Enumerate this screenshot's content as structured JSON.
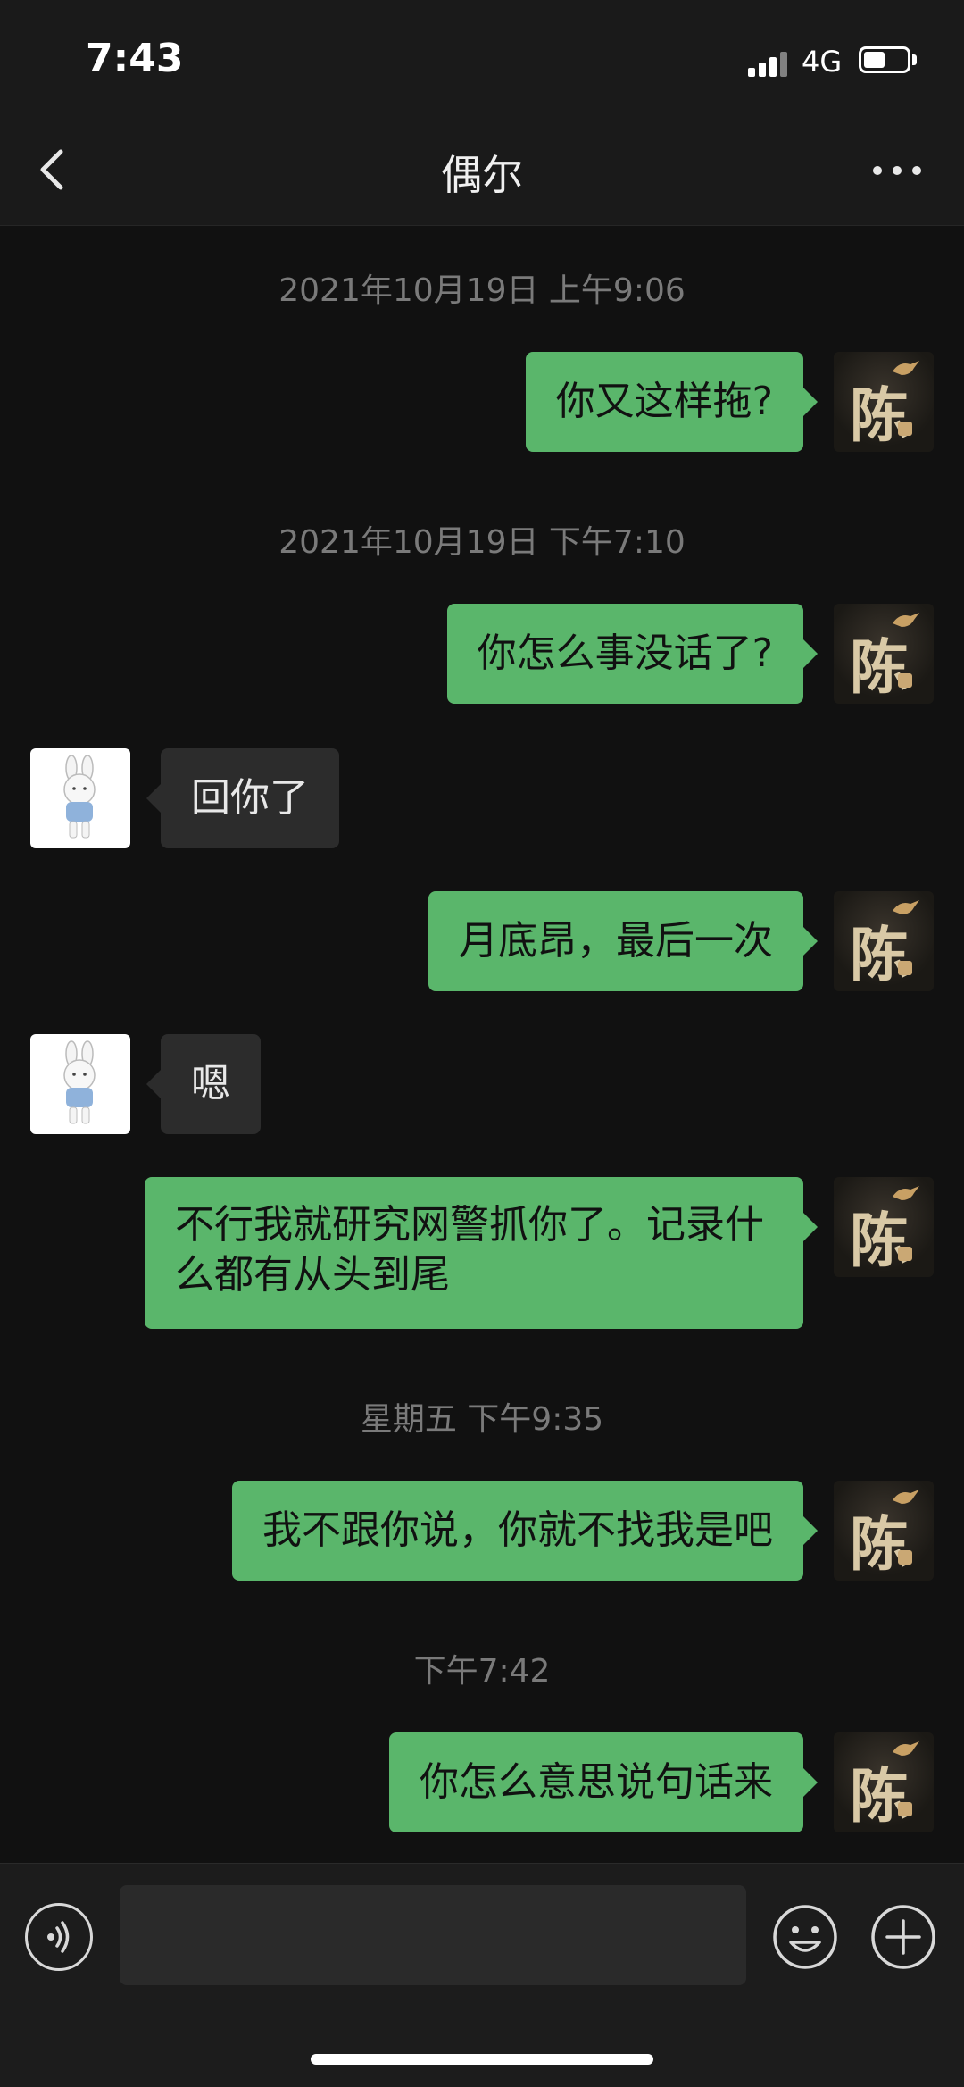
{
  "status_bar": {
    "time": "7:43",
    "network": "4G",
    "battery_level": 0.5
  },
  "header": {
    "title": "偶尔",
    "back_icon": "chevron-left-icon",
    "more_icon": "more-dots-icon"
  },
  "avatars": {
    "me_glyph": "陈",
    "friend_icon": "bunny-avatar-icon"
  },
  "timestamps": [
    "2021年10月19日 上午9:06",
    "2021年10月19日 下午7:10",
    "星期五 下午9:35",
    "下午7:42"
  ],
  "messages": [
    {
      "from": "me",
      "text": "你又这样拖?"
    },
    {
      "from": "me",
      "text": "你怎么事没话了?"
    },
    {
      "from": "friend",
      "text": "回你了"
    },
    {
      "from": "me",
      "text": "月底昂，最后一次"
    },
    {
      "from": "friend",
      "text": "嗯"
    },
    {
      "from": "me",
      "text": "不行我就研究网警抓你了。记录什么都有从头到尾"
    },
    {
      "from": "me",
      "text": "我不跟你说，你就不找我是吧"
    },
    {
      "from": "me",
      "text": "你怎么意思说句话来"
    }
  ],
  "input_bar": {
    "voice_icon": "voice-icon",
    "message_value": "",
    "emoji_icon": "emoji-icon",
    "plus_icon": "plus-icon"
  },
  "colors": {
    "background": "#111111",
    "bubble_out": "#5ab66b",
    "bubble_in": "#2c2c2c",
    "timestamp": "#7a7a7a"
  }
}
